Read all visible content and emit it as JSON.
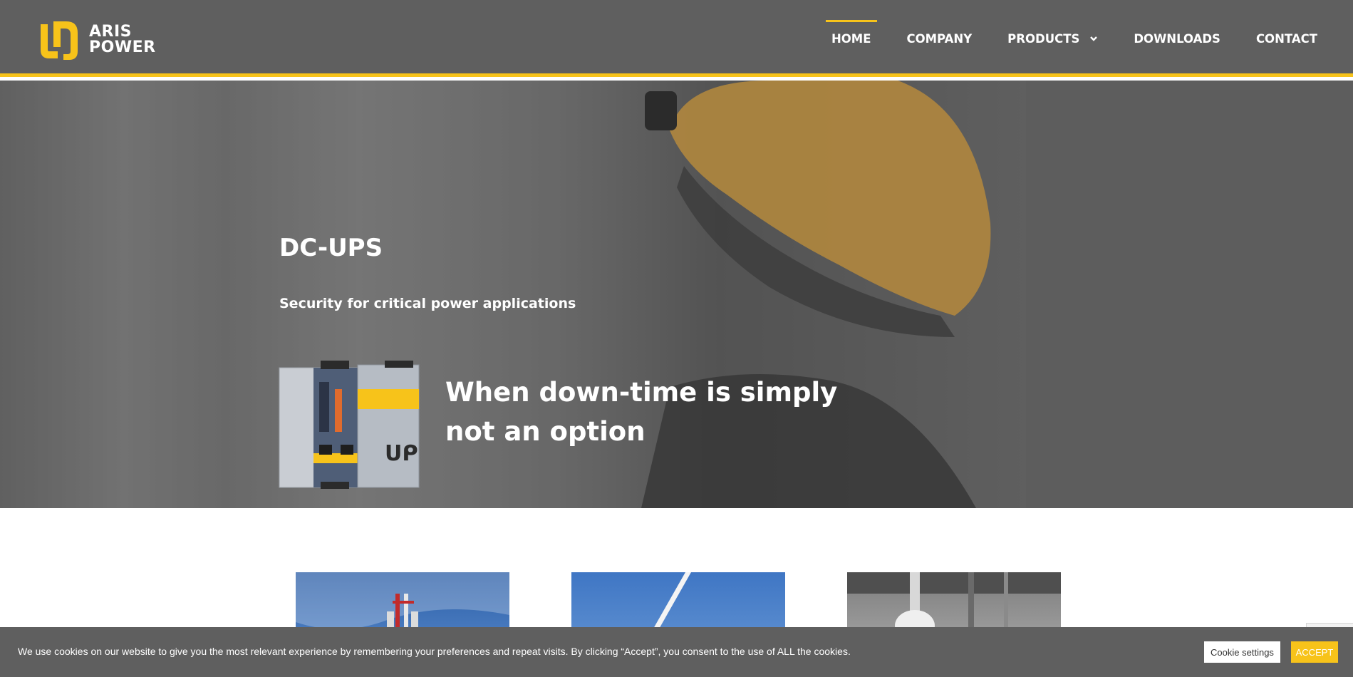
{
  "colors": {
    "accent": "#f7c31a",
    "header_bg": "#5f5f5f"
  },
  "brand": {
    "line1": "ARIS",
    "line2": "POWER"
  },
  "nav": [
    {
      "label": "HOME",
      "active": true
    },
    {
      "label": "COMPANY"
    },
    {
      "label": "PRODUCTS",
      "has_dropdown": true
    },
    {
      "label": "DOWNLOADS"
    },
    {
      "label": "CONTACT"
    }
  ],
  "hero": {
    "title": "DC-UPS",
    "subtitle": "Security for critical power applications",
    "tagline_line1": "When down-time is simply",
    "tagline_line2": "not an option"
  },
  "cookie": {
    "text": "We use cookies on our website to give you the most relevant experience by remembering your preferences and repeat visits. By clicking “Accept”, you consent to the use of ALL the cookies.",
    "settings_label": "Cookie settings",
    "accept_label": "ACCEPT"
  }
}
